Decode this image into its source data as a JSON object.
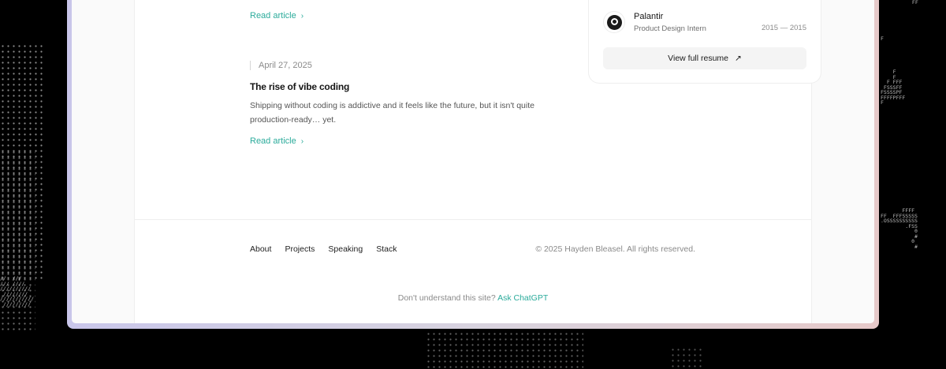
{
  "posts": [
    {
      "read_label": "Read article",
      "chevron": "›"
    },
    {
      "date": "April 27, 2025",
      "title": "The rise of vibe coding",
      "excerpt": "Shipping without coding is addictive and it feels like the future, but it isn't quite production-ready… yet.",
      "read_label": "Read article",
      "chevron": "›"
    }
  ],
  "resume": {
    "job": {
      "company": "Palantir",
      "role": "Product Design Intern",
      "dates": "2015 — 2015",
      "logo_icon": "palantir-logo-icon"
    },
    "button_label": "View full resume",
    "button_icon": "↗"
  },
  "footer": {
    "nav": [
      "About",
      "Projects",
      "Speaking",
      "Stack"
    ],
    "copyright": "© 2025 Hayden Bleasel. All rights reserved.",
    "help_text": "Don't understand this site?",
    "help_link": "Ask ChatGPT"
  },
  "colors": {
    "accent": "#2bab9b",
    "background": "#000000",
    "frame_gradient_start": "#c9c6ea",
    "frame_gradient_end": "#e6c9c9"
  }
}
